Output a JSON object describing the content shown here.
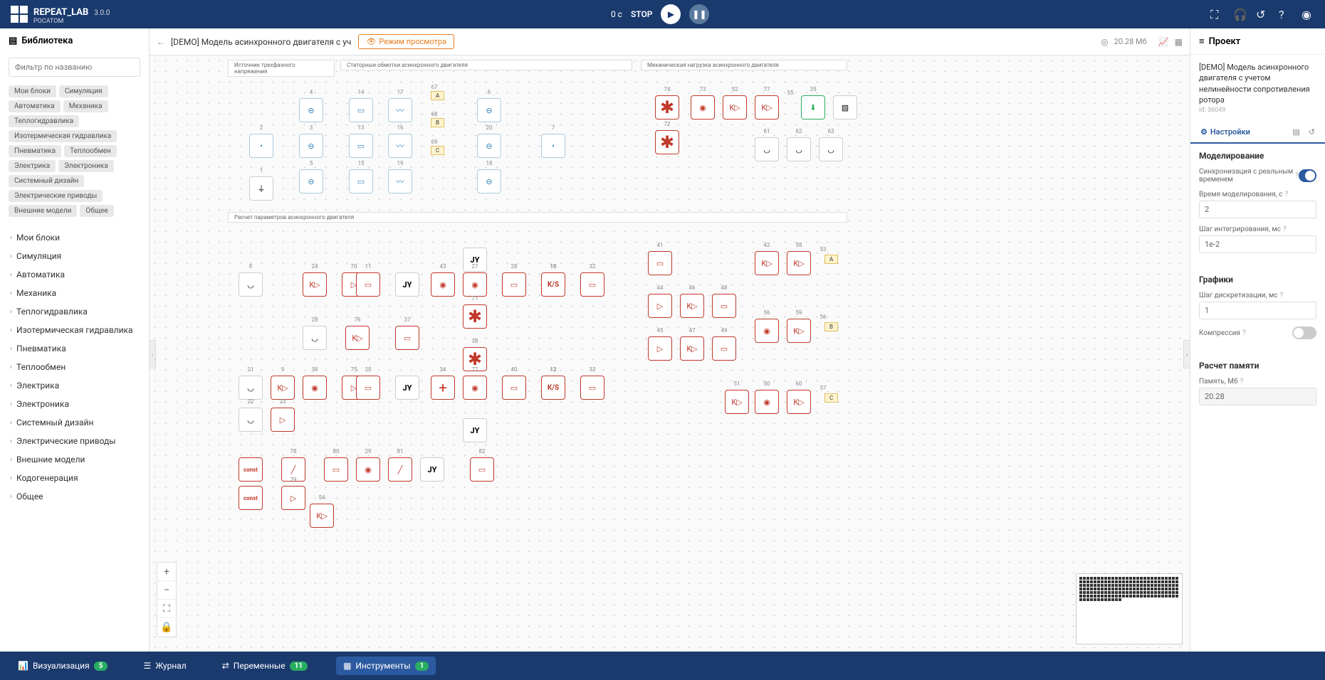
{
  "app": {
    "name": "REPEAT_LAB",
    "sub": "РОСАТОМ",
    "version": "3.0.0"
  },
  "header": {
    "time": "0 с",
    "stop": "STOP"
  },
  "library": {
    "title": "Библиотека",
    "filter_placeholder": "Фильтр по названию",
    "tags": [
      "Мои блоки",
      "Симуляция",
      "Автоматика",
      "Механика",
      "Теплогидравлика",
      "Изотермическая гидравлика",
      "Пневматика",
      "Теплообмен",
      "Электрика",
      "Электроника",
      "Системный дизайн",
      "Электрические приводы",
      "Внешние модели",
      "Общее"
    ],
    "tree": [
      "Мои блоки",
      "Симуляция",
      "Автоматика",
      "Механика",
      "Теплогидравлика",
      "Изотермическая гидравлика",
      "Пневматика",
      "Теплообмен",
      "Электрика",
      "Электроника",
      "Системный дизайн",
      "Электрические приводы",
      "Внешние модели",
      "Кодогенерация",
      "Общее"
    ]
  },
  "toolbar": {
    "title": "[DEMO] Модель асинхронного двигателя с уч",
    "view_mode": "Режим просмотра",
    "size": "20.28 Мб"
  },
  "canvas": {
    "groups": {
      "g1": "Источник трехфазного напряжения",
      "g2": "Статорные обмотки асинхронного двигателя",
      "g3": "Механическая нагрузка асинхронного двигателя",
      "g4": "Расчет параметров асинхронного двигателя"
    },
    "port_labels": {
      "a": "A",
      "b": "B",
      "c": "C"
    },
    "const_label": "const",
    "jy_label": "JY",
    "ks_label": "K/S",
    "k_label": "K"
  },
  "project_panel": {
    "header": "Проект",
    "title": "[DEMO] Модель асинхронного двигателя с учетом нелинейности сопротивления ротора",
    "id": "Id: 36049",
    "tab_settings": "Настройки",
    "sections": {
      "modeling": {
        "title": "Моделирование",
        "sync_label": "Синхронизация с реальным временем",
        "time_label": "Время моделирования, с",
        "time_value": "2",
        "step_label": "Шаг интегрирования, мс",
        "step_value": "1e-2"
      },
      "charts": {
        "title": "Графики",
        "disc_label": "Шаг дискретизации, мс",
        "disc_value": "1",
        "compression_label": "Компрессия"
      },
      "memory": {
        "title": "Расчет памяти",
        "mem_label": "Память, Мб",
        "mem_value": "20.28"
      }
    }
  },
  "footer": {
    "viz": "Визуализация",
    "viz_count": "5",
    "journal": "Журнал",
    "vars": "Переменные",
    "vars_count": "11",
    "tools": "Инструменты",
    "tools_count": "1"
  }
}
